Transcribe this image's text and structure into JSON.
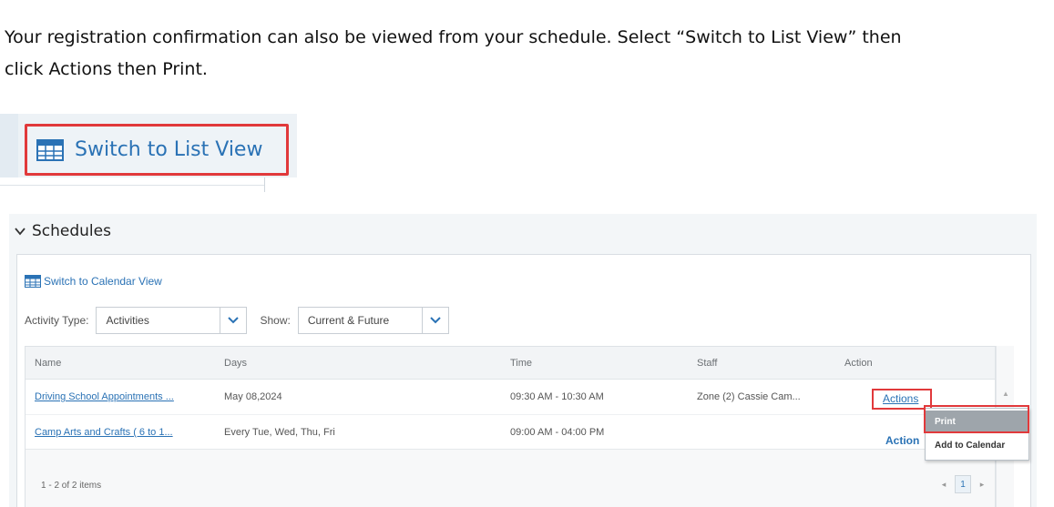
{
  "instructions": {
    "line1": "Your registration confirmation can also be viewed from your schedule. Select “Switch to List View” then",
    "line2": "click Actions then Print."
  },
  "list_view_button": {
    "label": "Switch to List View"
  },
  "schedules": {
    "title": "Schedules",
    "calendar_link": "Switch to Calendar View",
    "filters": {
      "activity_type_label": "Activity Type:",
      "activity_type_value": "Activities",
      "show_label": "Show:",
      "show_value": "Current & Future"
    },
    "columns": [
      "Name",
      "Days",
      "Time",
      "Staff",
      "Action"
    ],
    "rows": [
      {
        "name": "Driving School Appointments ...",
        "days": "May 08,2024",
        "time": "09:30 AM - 10:30 AM",
        "staff": "Zone (2) Cassie Cam...",
        "action": "Actions"
      },
      {
        "name": "Camp Arts and Crafts ( 6 to 1...",
        "days": "Every Tue, Wed, Thu, Fri",
        "time": "09:00 AM - 04:00 PM",
        "staff": "",
        "action": "Action"
      }
    ],
    "menu": {
      "print": "Print",
      "add_to_calendar": "Add to Calendar"
    },
    "footer": {
      "count": "1 - 2 of 2 items",
      "page": "1",
      "prev": "◂",
      "next": "▸"
    }
  },
  "colors": {
    "link": "#2a72b5",
    "highlight": "#e1393b"
  }
}
